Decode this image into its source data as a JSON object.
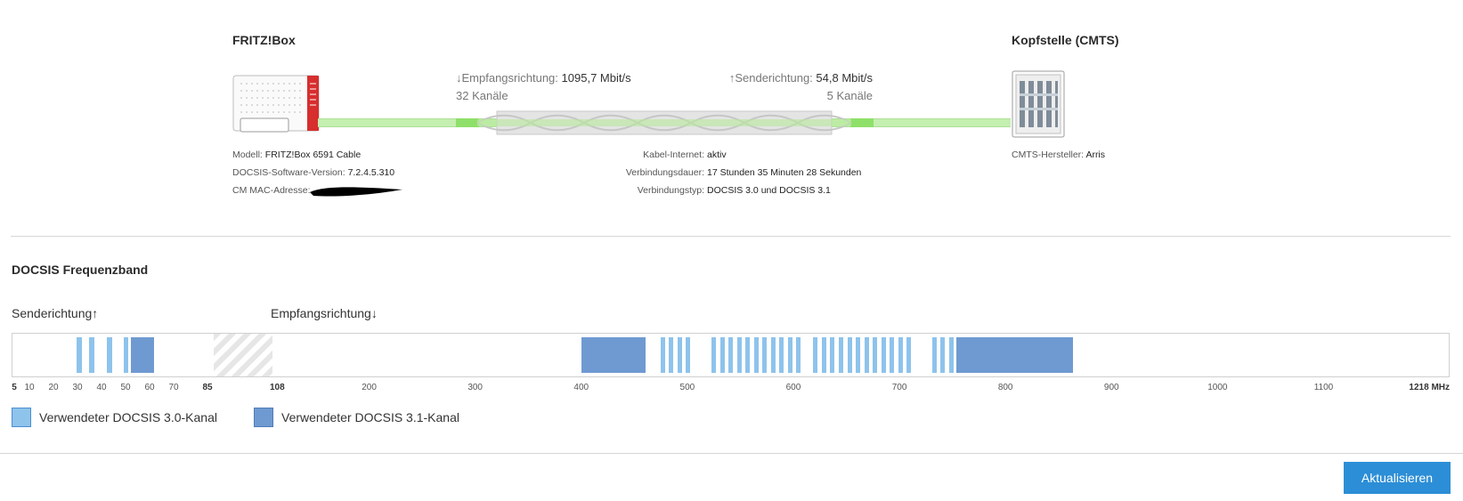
{
  "overview": {
    "fritzbox_title": "FRITZ!Box",
    "cmts_title": "Kopfstelle (CMTS)",
    "downstream": {
      "label": "↓Empfangsrichtung:",
      "rate": "1095,7 Mbit/s",
      "channels": "32 Kanäle"
    },
    "upstream": {
      "label": "↑Senderichtung:",
      "rate": "54,8 Mbit/s",
      "channels": "5 Kanäle"
    },
    "model": {
      "label": "Modell:",
      "value": "FRITZ!Box 6591 Cable"
    },
    "software": {
      "label": "DOCSIS-Software-Version:",
      "value": "7.2.4.5.310"
    },
    "mac": {
      "label": "CM MAC-Adresse:",
      "value": ""
    },
    "cable_internet": {
      "label": "Kabel-Internet:",
      "value": "aktiv"
    },
    "duration": {
      "label": "Verbindungsdauer:",
      "value": "17 Stunden 35 Minuten 28 Sekunden"
    },
    "conn_type": {
      "label": "Verbindungstyp:",
      "value": "DOCSIS 3.0 und DOCSIS 3.1"
    },
    "cmts_vendor": {
      "label": "CMTS-Hersteller:",
      "value": "Arris"
    }
  },
  "band": {
    "title": "DOCSIS Frequenzband",
    "up_label": "Senderichtung↑",
    "down_label": "Empfangsrichtung↓",
    "legend_30": "Verwendeter DOCSIS 3.0-Kanal",
    "legend_31": "Verwendeter DOCSIS 3.1-Kanal",
    "colors": {
      "docsis30": "#8ec3ec",
      "docsis31": "#6f9ad1",
      "accent": "#2c8ed6"
    },
    "ticks_up": [
      "5",
      "10",
      "20",
      "30",
      "40",
      "50",
      "60",
      "70",
      "85"
    ],
    "ticks_down": [
      "108",
      "200",
      "300",
      "400",
      "500",
      "600",
      "700",
      "800",
      "900",
      "1000",
      "1100",
      "1218 MHz"
    ],
    "up_channels": [
      {
        "mhz_from": 29.4,
        "mhz_to": 31.4,
        "type": "3.0"
      },
      {
        "mhz_from": 34.6,
        "mhz_to": 36.6,
        "type": "3.0"
      },
      {
        "mhz_from": 42.0,
        "mhz_to": 44.0,
        "type": "3.0"
      },
      {
        "mhz_from": 48.9,
        "mhz_to": 50.9,
        "type": "3.0"
      },
      {
        "mhz_from": 51.7,
        "mhz_to": 61.5,
        "type": "3.1"
      }
    ],
    "down_channels_31": [
      {
        "from": 399,
        "to": 460
      },
      {
        "from": 753,
        "to": 863
      }
    ],
    "down_channels_30": [
      474,
      482,
      490,
      498,
      522,
      530,
      538,
      546,
      554,
      562,
      570,
      578,
      586,
      594,
      602,
      618,
      626,
      634,
      642,
      650,
      658,
      666,
      674,
      682,
      690,
      698,
      706,
      730,
      738,
      746
    ]
  },
  "footer": {
    "refresh_label": "Aktualisieren"
  }
}
